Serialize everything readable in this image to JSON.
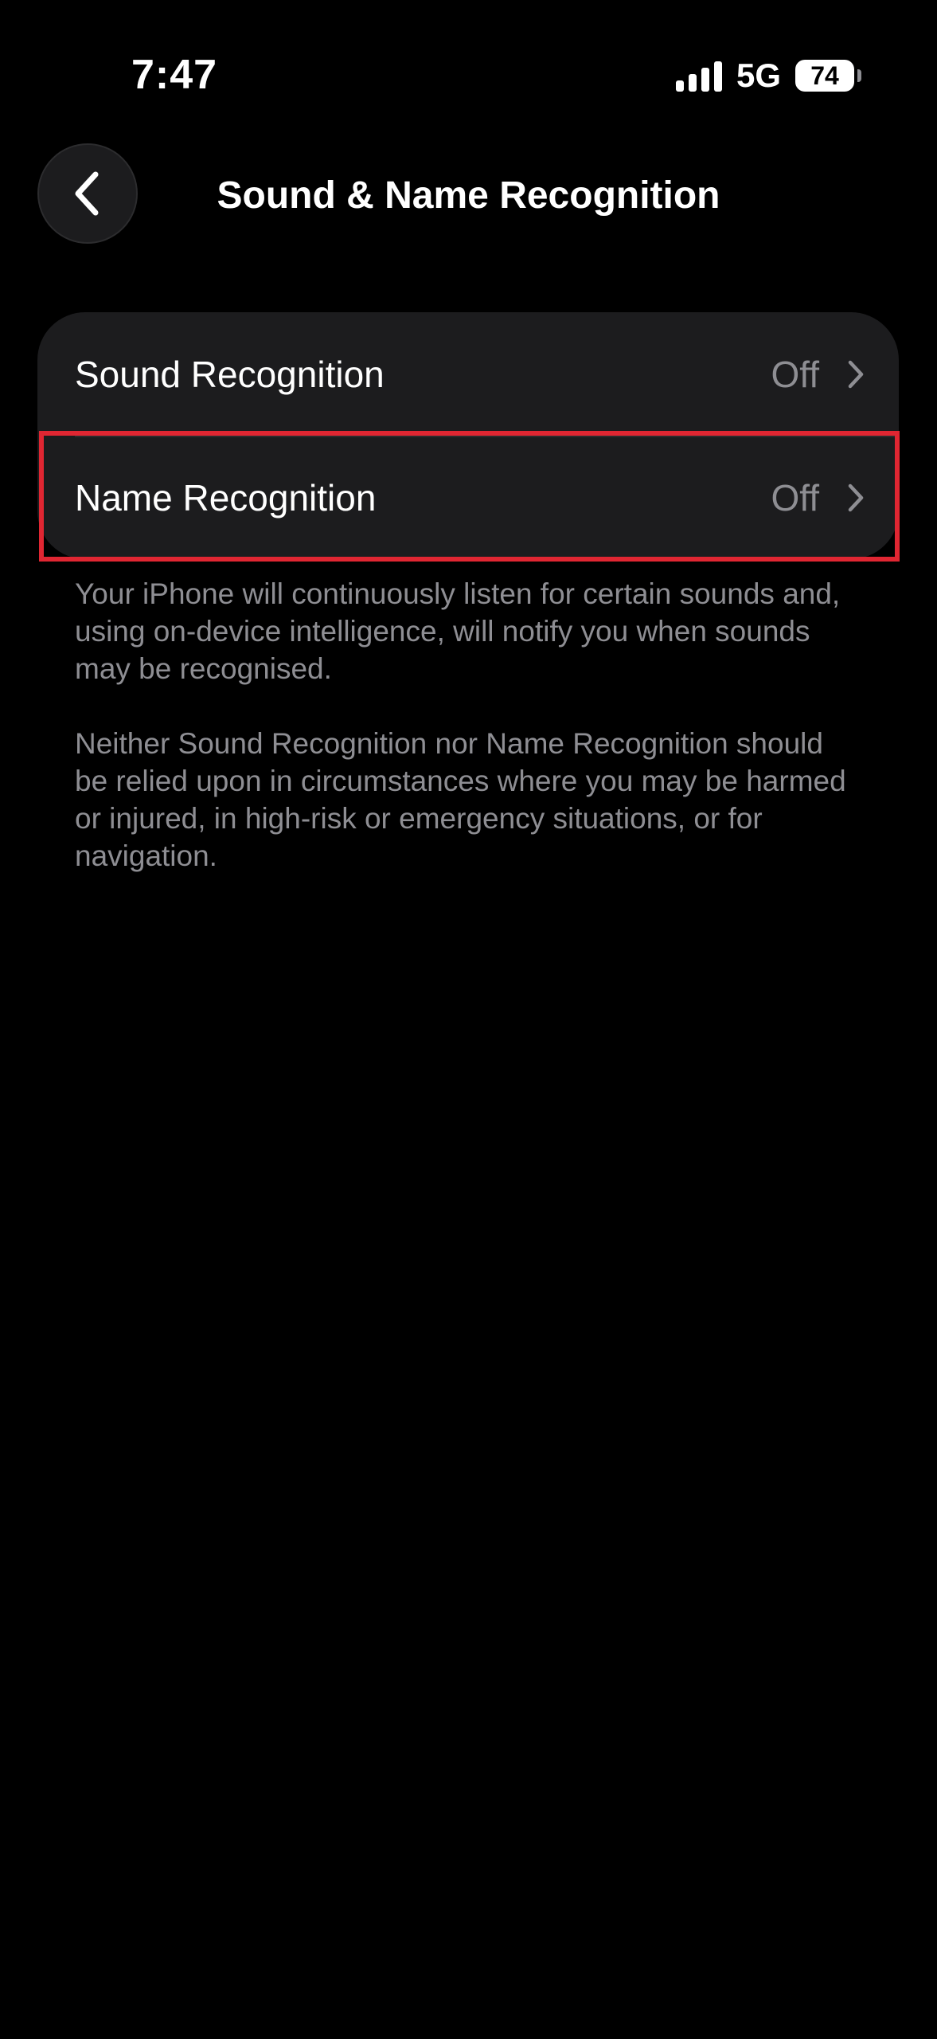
{
  "status_bar": {
    "time": "7:47",
    "network": "5G",
    "battery": "74",
    "icons": [
      "signal-icon",
      "battery-icon"
    ]
  },
  "nav": {
    "back_icon": "chevron-left-icon",
    "title": "Sound & Name Recognition"
  },
  "settings": {
    "items": [
      {
        "label": "Sound Recognition",
        "value": "Off",
        "icon": "chevron-right-icon"
      },
      {
        "label": "Name Recognition",
        "value": "Off",
        "icon": "chevron-right-icon"
      }
    ]
  },
  "footer": {
    "paragraph_1": "Your iPhone will continuously listen for certain sounds and, using on-device intelligence, will notify you when sounds may be recognised.",
    "paragraph_2": "Neither Sound Recognition nor Name Recognition should be relied upon in circumstances where you may be harmed or injured, in high-risk or emergency situations, or for navigation."
  },
  "colors": {
    "background": "#000000",
    "group_background": "#1c1c1e",
    "secondary_text": "#8e8e93",
    "highlight": "#e02632"
  }
}
